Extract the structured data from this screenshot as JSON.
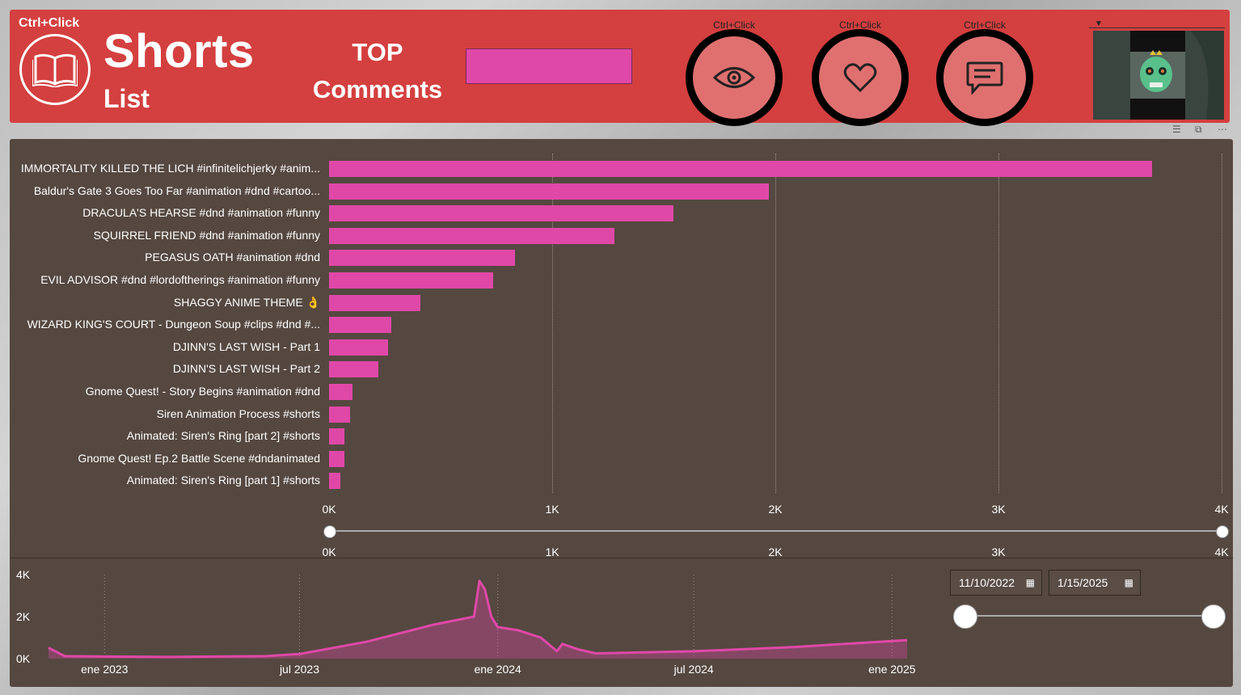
{
  "header": {
    "ctrl_click": "Ctrl+Click",
    "title_main": "Shorts",
    "title_sub": "List",
    "top_line1": "TOP",
    "top_line2": "Comments",
    "nav": [
      {
        "label": "Ctrl+Click",
        "icon": "eye-icon"
      },
      {
        "label": "Ctrl+Click",
        "icon": "heart-icon"
      },
      {
        "label": "Ctrl+Click",
        "icon": "comment-icon"
      }
    ],
    "accent": "#d43f3f",
    "pink": "#e048a8"
  },
  "bar_chart": {
    "type": "bar",
    "orientation": "horizontal",
    "categories": [
      "IMMORTALITY KILLED THE LICH #infinitelichjerky #anim...",
      "Baldur's Gate 3 Goes Too Far #animation #dnd #cartoo...",
      "DRACULA'S HEARSE #dnd #animation #funny",
      "SQUIRREL FRIEND #dnd #animation #funny",
      "PEGASUS OATH #animation #dnd",
      "EVIL ADVISOR #dnd #lordoftherings #animation #funny",
      "SHAGGY ANIME THEME 👌",
      "WIZARD KING'S COURT - Dungeon Soup #clips #dnd #...",
      "DJINN'S LAST WISH - Part 1",
      "DJINN'S LAST WISH - Part 2",
      "Gnome Quest! - Story Begins #animation #dnd",
      "Siren Animation Process #shorts",
      "Animated: Siren's Ring [part 2] #shorts",
      "Gnome Quest! Ep.2 Battle Scene #dndanimated",
      "Animated: Siren's Ring [part 1] #shorts"
    ],
    "values": [
      3690,
      1970,
      1545,
      1280,
      835,
      735,
      410,
      280,
      265,
      220,
      105,
      95,
      70,
      70,
      50
    ],
    "xlim": [
      0,
      4000
    ],
    "x_ticks": [
      "0K",
      "1K",
      "2K",
      "3K",
      "4K"
    ],
    "slider_ticks": [
      "0K",
      "1K",
      "2K",
      "3K",
      "4K"
    ],
    "slider_range": [
      0,
      4000
    ]
  },
  "area_chart": {
    "type": "area",
    "y_ticks": [
      "4K",
      "2K",
      "0K"
    ],
    "ylim": [
      0,
      4000
    ],
    "x_ticks": [
      "ene 2023",
      "jul 2023",
      "ene 2024",
      "jul 2024",
      "ene 2025"
    ],
    "x": [
      "2022-11-10",
      "2022-11-25",
      "2022-12-31",
      "2023-03-01",
      "2023-05-31",
      "2023-07-01",
      "2023-09-01",
      "2023-11-01",
      "2023-12-10",
      "2023-12-15",
      "2023-12-20",
      "2023-12-26",
      "2024-01-01",
      "2024-01-20",
      "2024-02-10",
      "2024-02-25",
      "2024-03-01",
      "2024-03-15",
      "2024-04-01",
      "2024-07-01",
      "2024-10-01",
      "2025-01-15"
    ],
    "y": [
      520,
      120,
      100,
      80,
      120,
      220,
      800,
      1600,
      2000,
      3700,
      3300,
      2000,
      1500,
      1350,
      1000,
      350,
      700,
      450,
      250,
      350,
      550,
      880
    ]
  },
  "date_filter": {
    "start": "11/10/2022",
    "end": "1/15/2025"
  }
}
